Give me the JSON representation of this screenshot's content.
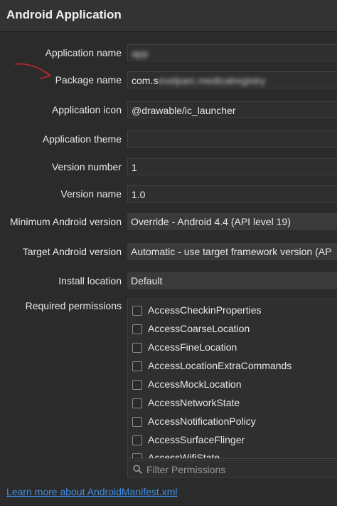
{
  "window": {
    "title": "Android Application"
  },
  "form": {
    "application_name": {
      "label": "Application name",
      "value": "app"
    },
    "package_name": {
      "label": "Package name",
      "value_prefix": "com.s",
      "value_blurred": "evelparc.medicalregistry"
    },
    "application_icon": {
      "label": "Application icon",
      "value": "@drawable/ic_launcher"
    },
    "application_theme": {
      "label": "Application theme",
      "value": ""
    },
    "version_number": {
      "label": "Version number",
      "value": "1"
    },
    "version_name": {
      "label": "Version name",
      "value": "1.0"
    },
    "min_android_version": {
      "label": "Minimum Android version",
      "value": "Override - Android 4.4 (API level 19)"
    },
    "target_android_version": {
      "label": "Target Android version",
      "value": "Automatic - use target framework version (AP"
    },
    "install_location": {
      "label": "Install location",
      "value": "Default"
    },
    "required_permissions": {
      "label": "Required permissions",
      "items": [
        "AccessCheckinProperties",
        "AccessCoarseLocation",
        "AccessFineLocation",
        "AccessLocationExtraCommands",
        "AccessMockLocation",
        "AccessNetworkState",
        "AccessNotificationPolicy",
        "AccessSurfaceFlinger",
        "AccessWifiState"
      ]
    },
    "filter": {
      "placeholder": "Filter Permissions",
      "icon": "search-icon"
    }
  },
  "footer": {
    "link_text": "Learn more about AndroidManifest.xml"
  },
  "colors": {
    "link": "#3d8fe6",
    "annotation_arrow": "#c0282d",
    "background": "#2b2b2b"
  }
}
